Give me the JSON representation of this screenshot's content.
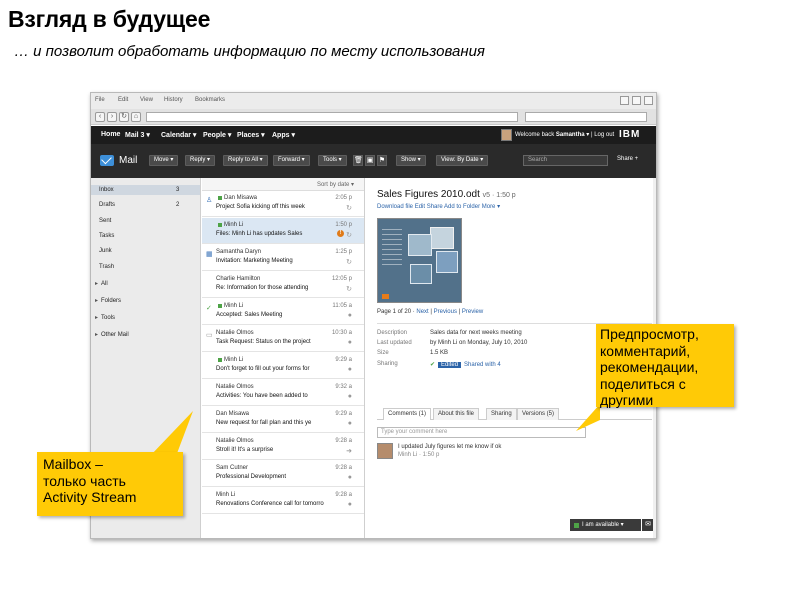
{
  "slide": {
    "title": "Взгляд в будущее",
    "subtitle": "… и позволит обработать информацию по месту использования"
  },
  "browser": {
    "menu": [
      "File",
      "Edit",
      "View",
      "History",
      "Bookmarks"
    ]
  },
  "nav": {
    "items": [
      "Home",
      "Mail 3 ▾",
      "Calendar ▾",
      "People ▾",
      "Places ▾",
      "Apps ▾"
    ],
    "welcome_prefix": "Welcome back",
    "welcome_name": "Samantha",
    "logout": "Log out",
    "brand": "IBM"
  },
  "toolbar": {
    "app_name": "Mail",
    "buttons": [
      "Move ▾",
      "Reply ▾",
      "Reply to All ▾",
      "Forward ▾",
      "Tools ▾",
      "Show ▾",
      "View: By Date ▾"
    ],
    "search_placeholder": "Search",
    "share_label": "Share +"
  },
  "sidebar": {
    "folders": [
      {
        "label": "Inbox",
        "count": "3"
      },
      {
        "label": "Drafts",
        "count": "2"
      },
      {
        "label": "Sent",
        "count": ""
      },
      {
        "label": "Tasks",
        "count": ""
      },
      {
        "label": "Junk",
        "count": ""
      },
      {
        "label": "Trash",
        "count": ""
      }
    ],
    "groups": [
      "All",
      "Folders",
      "Tools",
      "Other Mail"
    ]
  },
  "messages": {
    "sort_label": "Sort by date ▾",
    "items": [
      {
        "sender": "Dan Misawa",
        "subject": "Project Sofia kicking off this week",
        "time": "2:05 p"
      },
      {
        "sender": "Minh Li",
        "subject": "Files: Minh Li has updates Sales",
        "time": "1:50 p"
      },
      {
        "sender": "Samantha Daryn",
        "subject": "Invitation: Marketing Meeting",
        "time": "1:25 p"
      },
      {
        "sender": "Charlie Hamilton",
        "subject": "Re: Information for those attending",
        "time": "12:05 p"
      },
      {
        "sender": "Minh Li",
        "subject": "Accepted: Sales Meeting",
        "time": "11:05 a"
      },
      {
        "sender": "Natalie Olmos",
        "subject": "Task Request: Status on the project",
        "time": "10:30 a"
      },
      {
        "sender": "Minh Li",
        "subject": "Don't forget to fill out your forms for",
        "time": "9:29 a"
      },
      {
        "sender": "Natalie Olmos",
        "subject": "Activities: You have been added to",
        "time": "9:32 a"
      },
      {
        "sender": "Dan Misawa",
        "subject": "New request for fall plan and this ye",
        "time": "9:29 a"
      },
      {
        "sender": "Natalie Olmos",
        "subject": "Stroll it! It's a surprise",
        "time": "9:28 a"
      },
      {
        "sender": "Sam Cutner",
        "subject": "Professional Development",
        "time": "9:28 a"
      },
      {
        "sender": "Minh Li",
        "subject": "Renovations Conference call for tomorro",
        "time": "9:28 a"
      }
    ]
  },
  "preview": {
    "title": "Sales Figures 2010.odt",
    "version": "v5 · 1:50 p",
    "actions": "Download file   Edit   Share   Add to Folder   More ▾",
    "pager_label": "Page 1 of 20",
    "pager_next": "Next",
    "pager_prev": "Previous",
    "pager_preview": "Preview",
    "meta": [
      {
        "key": "Description",
        "value": "Sales data for next weeks meeting"
      },
      {
        "key": "Last updated",
        "value": "by Minh Li on Monday, July 10, 2010"
      },
      {
        "key": "Size",
        "value": "1.5 KB"
      }
    ],
    "sharing_label": "Sharing",
    "sharing_tag": "Edited",
    "sharing_with": "Shared with 4",
    "tabs": [
      "Comments (1)",
      "About this file",
      "Sharing",
      "Versions (5)"
    ],
    "comment_placeholder": "Type your comment here",
    "comment_text": "I updated July figures let me know if ok",
    "comment_meta": "Minh Li · 1:50 p",
    "status": "I am available ▾"
  },
  "callouts": {
    "left": "Mailbox –\nтолько часть\nActivity Stream",
    "right": "Предпросмотр,\nкомментарий,\nрекомендации,\nподелиться с\nдругими"
  },
  "colors": {
    "callout": "#ffca06",
    "navbar": "#1c1c1c",
    "toolbar": "#2a2a2a",
    "link": "#2b63a8"
  }
}
